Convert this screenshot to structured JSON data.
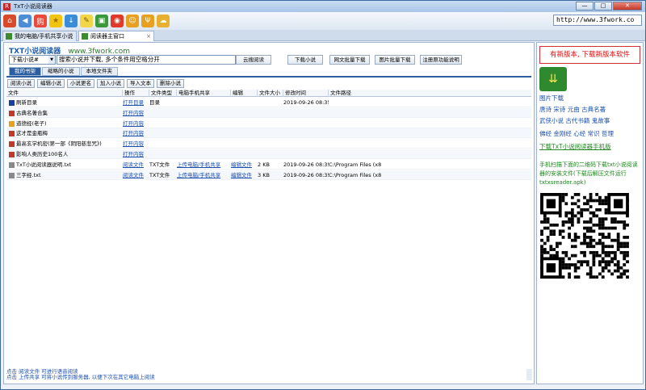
{
  "window": {
    "title": "TxT小说阅读器",
    "buttons": [
      "—",
      "□",
      "✕"
    ]
  },
  "toolbar": {
    "icons": [
      "home-icon",
      "back-icon",
      "shop-icon",
      "star-icon",
      "download-icon",
      "tips-icon",
      "plugin-icon",
      "chrome-icon",
      "face-icon",
      "fork-icon",
      "chat-icon"
    ],
    "address": "http://www.3fwork.co"
  },
  "tabs": [
    {
      "label": "我的电脑/手机共享小说"
    },
    {
      "label": "阅读器主窗口"
    }
  ],
  "right_controls": "☆  ☰",
  "header": {
    "logo": "TXT小说阅读器",
    "url": "www.3fwork.com"
  },
  "search": {
    "select_value": "下载小说#",
    "input_value": "搜索小说并下载, 多个条件用空格分开"
  },
  "buttons": {
    "cloud": "云搜阅读",
    "download": "下载小说",
    "batch_text": "网文批量下载",
    "batch_img": "图片批量下载",
    "register": "注册原功能说明"
  },
  "subtabs": [
    "我的书架",
    "缩略的小说",
    "本地文件夹"
  ],
  "actions": [
    "阅读小说",
    "编辑小说",
    "小说更名",
    "加入小说",
    "导入文本",
    "删除小说"
  ],
  "columns": [
    "文件",
    "操作",
    "文件类型",
    "电脑手机共享",
    "编辑",
    "文件大小",
    "修改时间",
    "文件路径"
  ],
  "rows": [
    {
      "name": "刷新目录",
      "op": "打开目录",
      "type": "目录",
      "share": "",
      "edit": "",
      "size": "",
      "time": "2019-09-26 08:35",
      "path": "",
      "icon": "#1a3fa0"
    },
    {
      "name": "古典名著合集",
      "op": "打开内容",
      "type": "",
      "share": "",
      "edit": "",
      "size": "",
      "time": "",
      "path": "",
      "icon": "#c03a2a"
    },
    {
      "name": "道德经(老子)",
      "op": "打开内容",
      "type": "",
      "share": "",
      "edit": "",
      "size": "",
      "time": "",
      "path": "",
      "icon": "#e8a020"
    },
    {
      "name": "这才是金瓶梅",
      "op": "打开内容",
      "type": "",
      "share": "",
      "edit": "",
      "size": "",
      "time": "",
      "path": "",
      "icon": "#c03a2a"
    },
    {
      "name": "最高玄学机密(第一部《阴阳慈悲咒》)",
      "op": "打开内容",
      "type": "",
      "share": "",
      "edit": "",
      "size": "",
      "time": "",
      "path": "",
      "icon": "#c03a2a"
    },
    {
      "name": "影响人类历史100名人",
      "op": "打开内容",
      "type": "",
      "share": "",
      "edit": "",
      "size": "",
      "time": "",
      "path": "",
      "icon": "#c03a2a"
    },
    {
      "name": "TxT小说阅读器说明.txt",
      "op": "阅读文件",
      "type": "TXT文件",
      "share": "上传电脑/手机共享",
      "edit": "编辑文件",
      "size": "2 KB",
      "time": "2019-09-26 08:35",
      "path": "C:\\Program Files (x8",
      "icon": "#888888"
    },
    {
      "name": "三字经.txt",
      "op": "阅读文件",
      "type": "TXT文件",
      "share": "上传电脑/手机共享",
      "edit": "编辑文件",
      "size": "3 KB",
      "time": "2019-09-26 08:35",
      "path": "C:\\Program Files (x8",
      "icon": "#888888"
    }
  ],
  "status": {
    "line1": "点击  阅读文件  可进行语音阅读",
    "line2": "点击  上传共享  可将小说传到服务器, 以便下次在其它电脑上阅读"
  },
  "sidebar": {
    "new_version": "有新版本, 下载新版本软件",
    "links1": [
      "图片下载",
      "唐诗  宋诗  元曲  古典名著",
      "武侠小说  古代书籍  鬼故事",
      "佛经  金刚经  心经  常识  哲理"
    ],
    "mobile_link": "下载TxT小说阅读器手机版",
    "qr_text": "手机扫描下面的二维码下载txt小说阅读器的安装文件(下载后解压文件运行txtxsreader.apk)"
  }
}
